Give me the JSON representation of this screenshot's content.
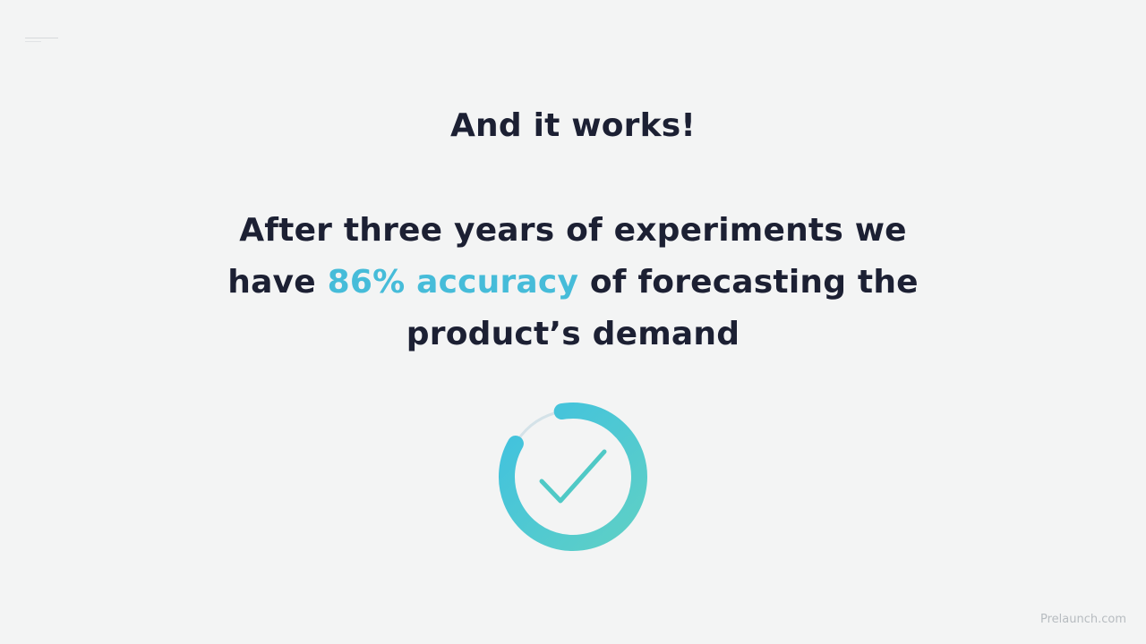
{
  "slide": {
    "heading": "And it works!",
    "body_line1": "After three years of experiments we",
    "body_line2_before": "have ",
    "body_highlight": "86% accuracy",
    "body_line2_after": " of forecasting the",
    "body_line3": "product’s demand"
  },
  "progress_ring": {
    "fraction": 0.86,
    "icon": "checkmark-icon",
    "colors": {
      "gradient_start": "#3fc1e0",
      "gradient_end": "#5fd0c5",
      "track": "#d4e2e8",
      "check": "#4fc9c6"
    }
  },
  "footer": {
    "brand": "Prelaunch.com"
  },
  "colors": {
    "background": "#f3f4f4",
    "text": "#1c2033",
    "accent": "#46bcd9",
    "muted": "#b7bcc0"
  }
}
